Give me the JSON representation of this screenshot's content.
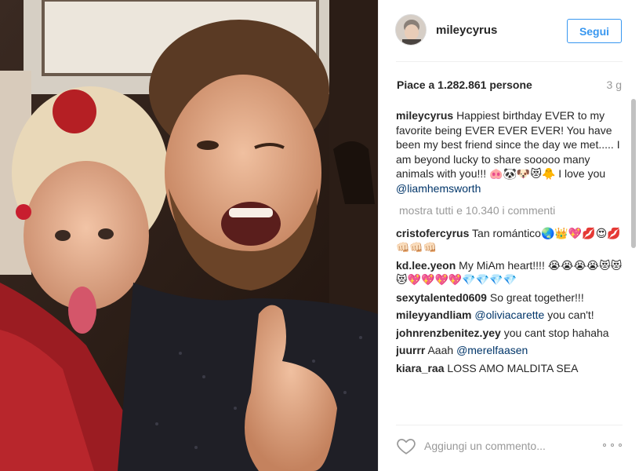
{
  "photo": {
    "alt": "Selfie of two people"
  },
  "header": {
    "username": "mileycyrus",
    "follow_label": "Segui"
  },
  "stats": {
    "likes": "Piace a 1.282.861 persone",
    "time": "3 g"
  },
  "caption": {
    "user": "mileycyrus",
    "text": "Happiest birthday EVER to my favorite being EVER EVER EVER! You have been my best friend since the day we met..... I am beyond lucky to share sooooo many animals with you!!! 🐽🐼🐶😻🐥 I love you ",
    "mention": "@liamhemsworth"
  },
  "show_all": "mostra tutti e 10.340 i commenti",
  "comments": [
    {
      "user": "cristofercyrus",
      "text": "Tan romántico🌏👑💖💋😍💋👊🏻👊🏻👊🏻",
      "mention": ""
    },
    {
      "user": "kd.lee.yeon",
      "text": "My MiAm heart!!!! 😭😭😭😭😻😻😻💖💖💖💖💎💎💎💎",
      "mention": ""
    },
    {
      "user": "sexytalented0609",
      "text": "So great together!!!",
      "mention": ""
    },
    {
      "user": "mileyyandliam",
      "text": "",
      "mention": "@oliviacarette",
      "after": " you can't!"
    },
    {
      "user": "johnrenzbenitez.yey",
      "text": "you cant stop hahaha",
      "mention": ""
    },
    {
      "user": "juurrr",
      "text": "Aaah ",
      "mention": "@merelfaasen"
    },
    {
      "user": "kiara_raa",
      "text": "LOSS AMO MALDITA SEA",
      "mention": ""
    }
  ],
  "footer": {
    "comment_placeholder": "Aggiungi un commento...",
    "more_label": "ooo"
  },
  "colors": {
    "accent": "#3897f0",
    "mention": "#003569",
    "muted": "#999999"
  },
  "icons": {
    "like": "heart-outline-icon",
    "more": "three-dots-icon"
  }
}
